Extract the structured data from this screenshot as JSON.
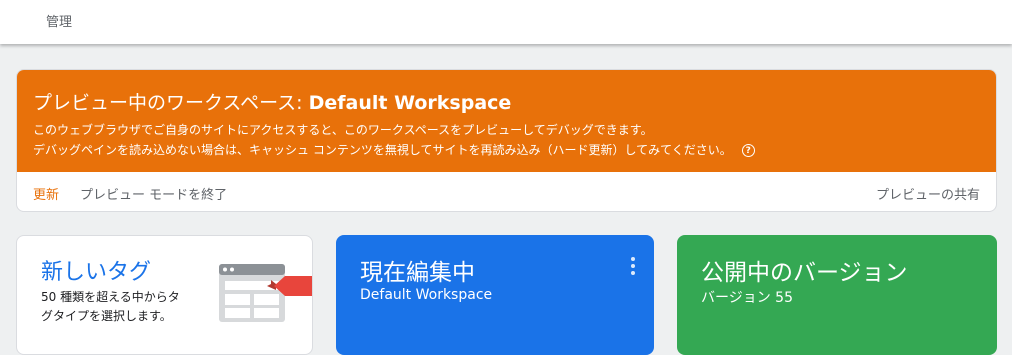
{
  "topbar": {
    "admin_label": "管理"
  },
  "preview": {
    "title_prefix": "プレビュー中のワークスペース: ",
    "workspace_name": "Default Workspace",
    "description_line1": "このウェブブラウザでご自身のサイトにアクセスすると、このワークスペースをプレビューしてデバッグできます。",
    "description_line2": "デバッグペインを読み込めない場合は、キャッシュ コンテンツを無視してサイトを再読み込み（ハード更新）してみてください。",
    "help_glyph": "?",
    "refresh_label": "更新",
    "exit_label": "プレビュー モードを終了",
    "share_label": "プレビューの共有",
    "banner_color": "#e8710a"
  },
  "cards": {
    "new_tag": {
      "title": "新しいタグ",
      "description": "50 種類を超える中からタグタイプを選択します。",
      "icon": "tag-illustration-icon"
    },
    "editing": {
      "title": "現在編集中",
      "subtitle": "Default Workspace",
      "color": "#1a73e8",
      "menu_icon": "more-vert-icon"
    },
    "published": {
      "title": "公開中のバージョン",
      "subtitle": "バージョン 55",
      "color": "#34a853"
    }
  }
}
